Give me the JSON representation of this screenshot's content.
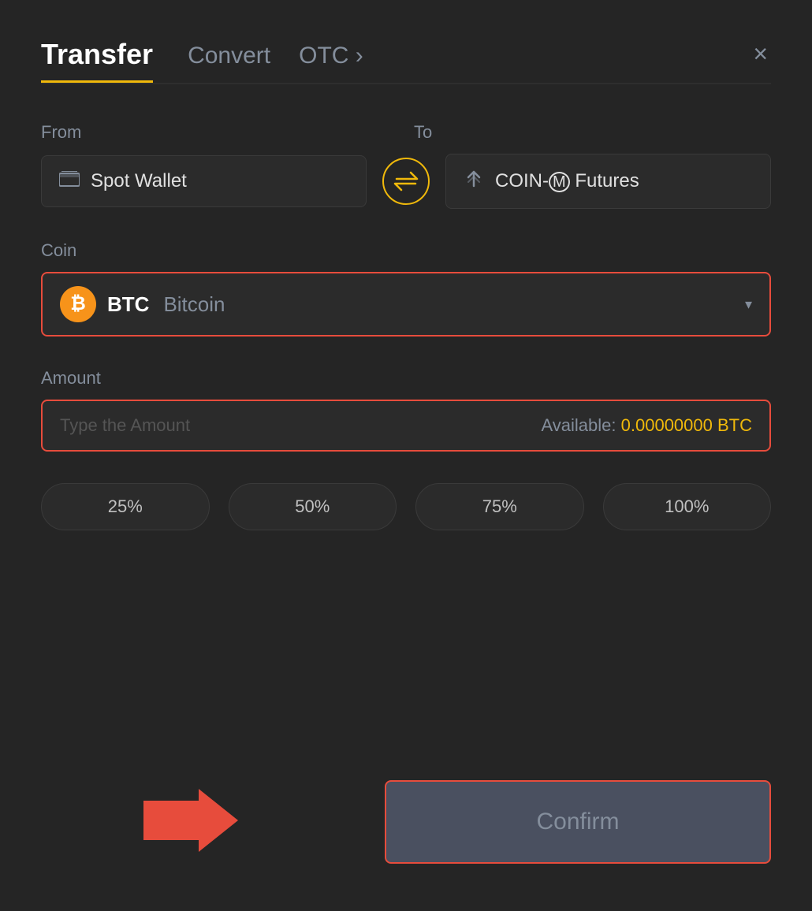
{
  "modal": {
    "background_color": "#252525"
  },
  "header": {
    "active_tab": "Transfer",
    "tabs": [
      {
        "id": "transfer",
        "label": "Transfer",
        "active": true
      },
      {
        "id": "convert",
        "label": "Convert",
        "active": false
      },
      {
        "id": "otc",
        "label": "OTC ›",
        "active": false
      }
    ],
    "close_label": "×"
  },
  "from": {
    "label": "From",
    "wallet_icon": "▬",
    "wallet_name": "Spot Wallet"
  },
  "swap": {
    "icon": "⇄"
  },
  "to": {
    "label": "To",
    "futures_icon": "↑",
    "futures_name": "COIN-Ⓜ Futures"
  },
  "coin": {
    "label": "Coin",
    "selected_symbol": "BTC",
    "selected_name": "Bitcoin",
    "dropdown_arrow": "▾"
  },
  "amount": {
    "label": "Amount",
    "placeholder": "Type the Amount",
    "available_label": "Available:",
    "available_value": "0.00000000",
    "available_currency": "BTC"
  },
  "pct_buttons": [
    {
      "label": "25%",
      "value": 25
    },
    {
      "label": "50%",
      "value": 50
    },
    {
      "label": "75%",
      "value": 75
    },
    {
      "label": "100%",
      "value": 100
    }
  ],
  "confirm": {
    "label": "Confirm"
  }
}
